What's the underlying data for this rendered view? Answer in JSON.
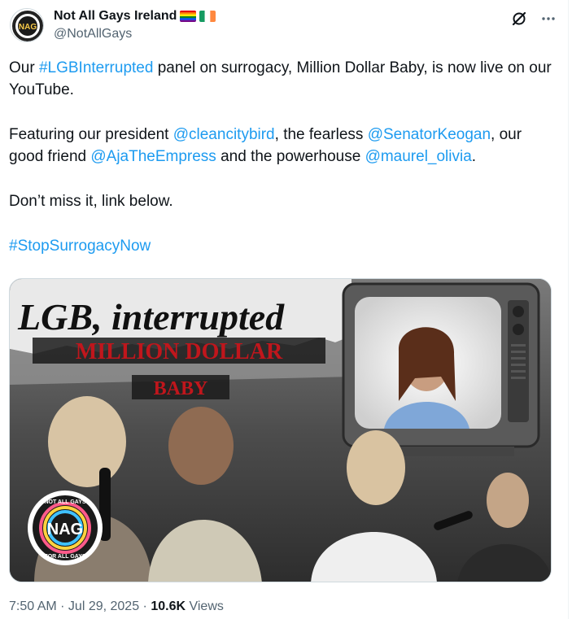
{
  "account": {
    "display_name": "Not All Gays Ireland",
    "handle": "@NotAllGays",
    "avatar_text": "NAG"
  },
  "tweet": {
    "line1_pre": "Our ",
    "hashtag1": "#LGBInterrupted",
    "line1_post": " panel on surrogacy, Million Dollar Baby, is now live on our YouTube.",
    "p2_a": "Featuring our president ",
    "mention1": "@cleancitybird",
    "p2_b": ", the fearless ",
    "mention2": "@SenatorKeogan",
    "p2_c": ", our good friend ",
    "mention3": "@AjaTheEmpress",
    "p2_d": " and the powerhouse ",
    "mention4": "@maurel_olivia",
    "p2_e": ".",
    "p3": "Don’t miss it, link below.",
    "hashtag2": "#StopSurrogacyNow"
  },
  "media": {
    "title_line": "LGB, interrupted",
    "subtitle": "MILLION DOLLAR",
    "subtitle2": "BABY",
    "logo_top": "NOT ALL GAYS",
    "logo_bottom": "FOR ALL GAYS",
    "logo_center": "NAG"
  },
  "meta": {
    "time": "7:50 AM · Jul 29, 2025 · ",
    "views_count": "10.6K",
    "views_label": " Views"
  },
  "icons": [
    "grok-icon",
    "more-icon",
    "rainbow-flag-icon",
    "ireland-flag-icon"
  ],
  "colors": {
    "link": "#1d9bf0",
    "secondary": "#536471",
    "text": "#0f1419"
  }
}
